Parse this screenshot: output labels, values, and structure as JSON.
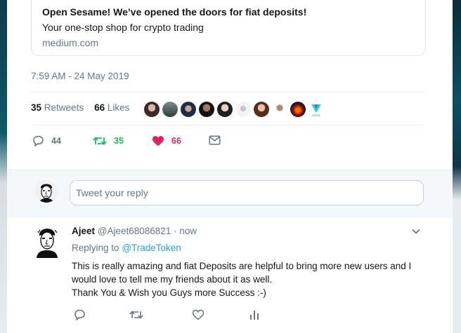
{
  "card": {
    "title": "Open Sesame! We’ve opened the doors for fiat deposits!",
    "description": "Your one-stop shop for crypto trading",
    "domain": "medium.com"
  },
  "tweet": {
    "timestamp": "7:59 AM - 24 May 2019",
    "retweet_count": "35",
    "retweet_label": "Retweets",
    "like_count": "66",
    "like_label": "Likes",
    "actions": {
      "reply_count": "44",
      "retweet_count": "35",
      "like_count": "66"
    }
  },
  "reply_box": {
    "placeholder": "Tweet your reply"
  },
  "reply": {
    "name": "Ajeet",
    "handle": "@Ajeet68086821",
    "separator": "·",
    "time": "now",
    "replying_prefix": "Replying to",
    "replying_to": "@TradeToken",
    "text_lines": [
      "This is really amazing and fiat Deposits are helpful to bring more new users and I",
      "would love to tell me my friends about it as well.",
      "Thank You & Wish you Guys more Success :-)"
    ]
  },
  "colors": {
    "retweet_green": "#17bf63",
    "like_red": "#e0245e",
    "link_blue": "#1da1f2",
    "muted": "#657786"
  },
  "icons": [
    "reply-icon",
    "retweet-icon",
    "heart-icon",
    "mail-icon",
    "chevron-down-icon",
    "stats-icon"
  ]
}
